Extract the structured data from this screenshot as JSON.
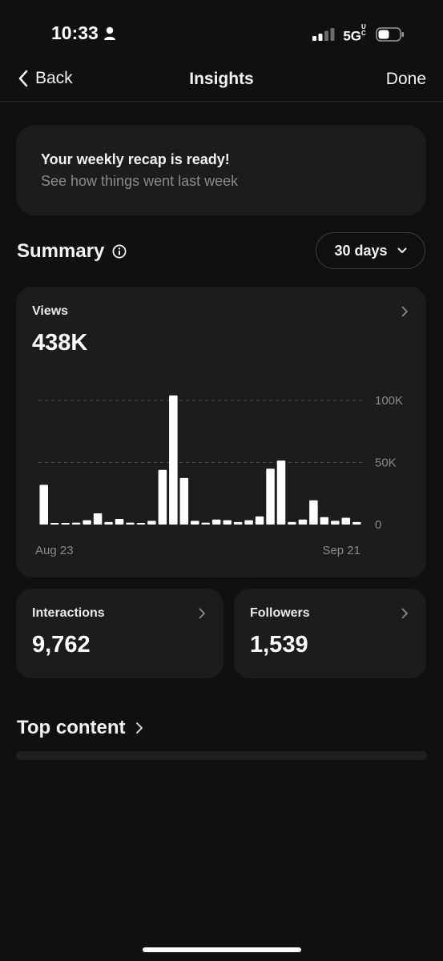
{
  "status_bar": {
    "time": "10:33",
    "network": "5G",
    "network_sup": "UC"
  },
  "nav": {
    "back_label": "Back",
    "title": "Insights",
    "done_label": "Done"
  },
  "recap": {
    "title": "Your weekly recap is ready!",
    "subtitle": "See how things went last week"
  },
  "summary": {
    "title": "Summary",
    "range_label": "30 days"
  },
  "views": {
    "label": "Views",
    "value": "438K"
  },
  "chart_data": {
    "type": "bar",
    "x_start_label": "Aug 23",
    "x_end_label": "Sep 21",
    "y_ticks": [
      "100K",
      "50K",
      "0"
    ],
    "y_tick_values": [
      100000,
      50000,
      0
    ],
    "ylim": [
      0,
      100000
    ],
    "grid": true,
    "values": [
      32000,
      1000,
      500,
      1500,
      3500,
      9000,
      2000,
      4500,
      1500,
      500,
      3000,
      44000,
      104000,
      37500,
      3000,
      1500,
      4000,
      3500,
      2000,
      3500,
      6500,
      45000,
      51500,
      2000,
      4000,
      19500,
      6000,
      3000,
      5500,
      2000
    ]
  },
  "interactions": {
    "label": "Interactions",
    "value": "9,762"
  },
  "followers": {
    "label": "Followers",
    "value": "1,539"
  },
  "top_content": {
    "title": "Top content"
  }
}
